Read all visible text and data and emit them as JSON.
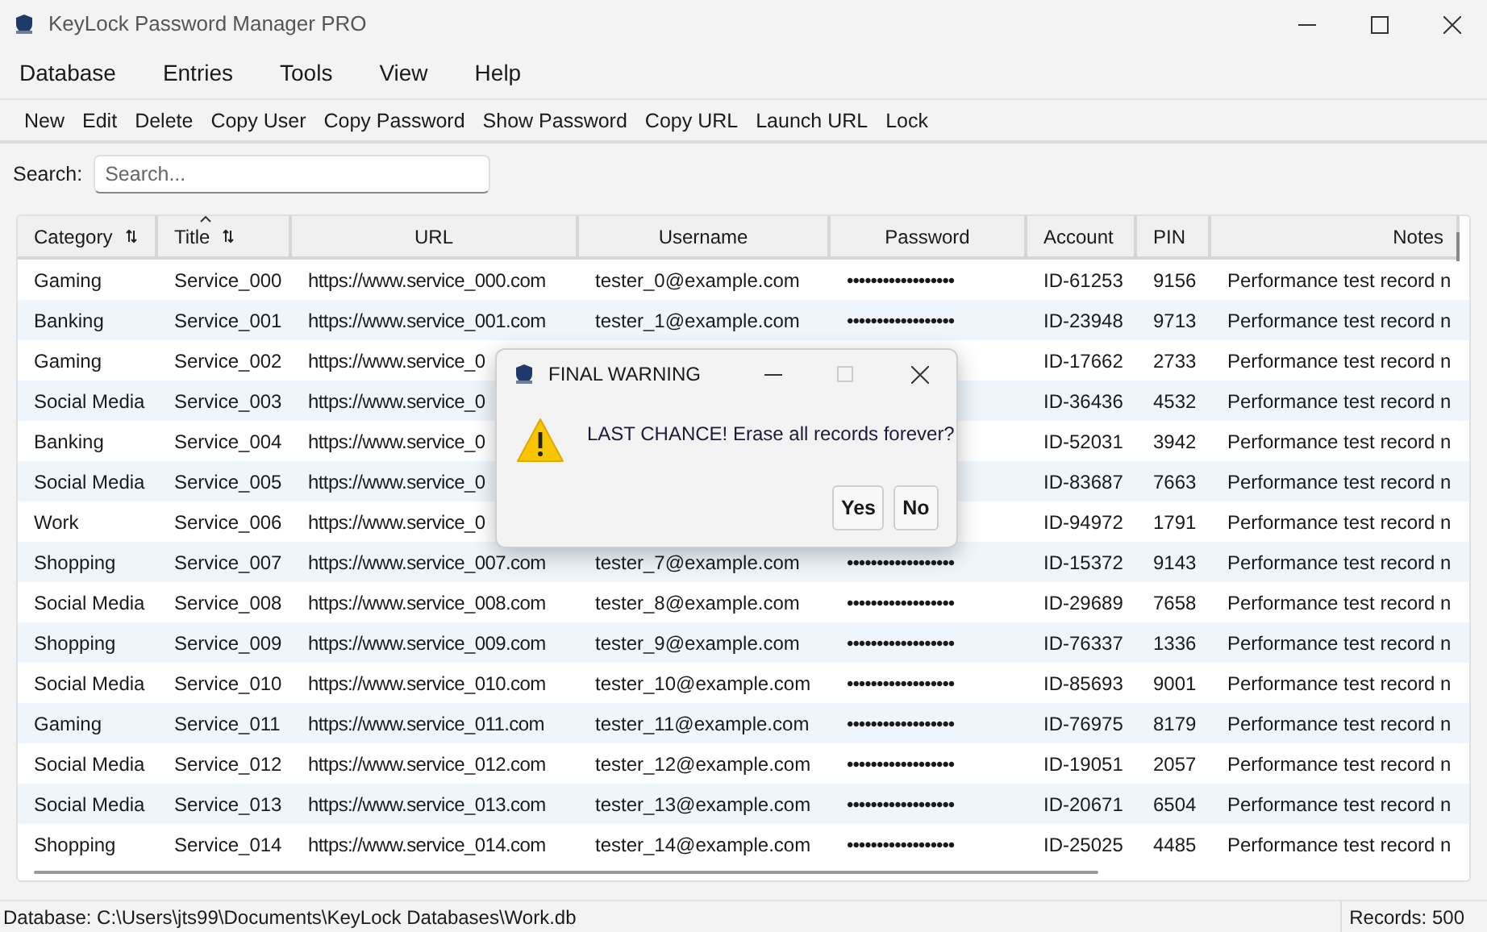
{
  "window": {
    "title": "KeyLock Password Manager PRO"
  },
  "menu": [
    "Database",
    "Entries",
    "Tools",
    "View",
    "Help"
  ],
  "toolbar": [
    "New",
    "Edit",
    "Delete",
    "Copy User",
    "Copy Password",
    "Show Password",
    "Copy URL",
    "Launch URL",
    "Lock"
  ],
  "search": {
    "label": "Search:",
    "placeholder": "Search..."
  },
  "table": {
    "columns": [
      {
        "label": "Category",
        "sortable": true,
        "sorted": false
      },
      {
        "label": "Title",
        "sortable": true,
        "sorted": true
      },
      {
        "label": "URL",
        "sortable": false,
        "sorted": false
      },
      {
        "label": "Username",
        "sortable": false,
        "sorted": false
      },
      {
        "label": "Password",
        "sortable": false,
        "sorted": false
      },
      {
        "label": "Account",
        "sortable": false,
        "sorted": false
      },
      {
        "label": "PIN",
        "sortable": false,
        "sorted": false
      },
      {
        "label": "Notes",
        "sortable": false,
        "sorted": false
      }
    ],
    "rows": [
      {
        "category": "Gaming",
        "title": "Service_000",
        "url": "https://www.service_000.com",
        "username": "tester_0@example.com",
        "password": "••••••••••••••••••",
        "account": "ID-61253",
        "pin": "9156",
        "notes": "Performance test record n"
      },
      {
        "category": "Banking",
        "title": "Service_001",
        "url": "https://www.service_001.com",
        "username": "tester_1@example.com",
        "password": "••••••••••••••••••",
        "account": "ID-23948",
        "pin": "9713",
        "notes": "Performance test record n"
      },
      {
        "category": "Gaming",
        "title": "Service_002",
        "url": "https://www.service_0",
        "account": "ID-17662",
        "pin": "2733",
        "notes": "Performance test record n"
      },
      {
        "category": "Social Media",
        "title": "Service_003",
        "url": "https://www.service_0",
        "account": "ID-36436",
        "pin": "4532",
        "notes": "Performance test record n"
      },
      {
        "category": "Banking",
        "title": "Service_004",
        "url": "https://www.service_0",
        "account": "ID-52031",
        "pin": "3942",
        "notes": "Performance test record n"
      },
      {
        "category": "Social Media",
        "title": "Service_005",
        "url": "https://www.service_0",
        "account": "ID-83687",
        "pin": "7663",
        "notes": "Performance test record n"
      },
      {
        "category": "Work",
        "title": "Service_006",
        "url": "https://www.service_0",
        "account": "ID-94972",
        "pin": "1791",
        "notes": "Performance test record n"
      },
      {
        "category": "Shopping",
        "title": "Service_007",
        "url": "https://www.service_007.com",
        "username": "tester_7@example.com",
        "password": "••••••••••••••••••",
        "account": "ID-15372",
        "pin": "9143",
        "notes": "Performance test record n"
      },
      {
        "category": "Social Media",
        "title": "Service_008",
        "url": "https://www.service_008.com",
        "username": "tester_8@example.com",
        "password": "••••••••••••••••••",
        "account": "ID-29689",
        "pin": "7658",
        "notes": "Performance test record n"
      },
      {
        "category": "Shopping",
        "title": "Service_009",
        "url": "https://www.service_009.com",
        "username": "tester_9@example.com",
        "password": "••••••••••••••••••",
        "account": "ID-76337",
        "pin": "1336",
        "notes": "Performance test record n"
      },
      {
        "category": "Social Media",
        "title": "Service_010",
        "url": "https://www.service_010.com",
        "username": "tester_10@example.com",
        "password": "••••••••••••••••••",
        "account": "ID-85693",
        "pin": "9001",
        "notes": "Performance test record n"
      },
      {
        "category": "Gaming",
        "title": "Service_011",
        "url": "https://www.service_011.com",
        "username": "tester_11@example.com",
        "password": "••••••••••••••••••",
        "account": "ID-76975",
        "pin": "8179",
        "notes": "Performance test record n"
      },
      {
        "category": "Social Media",
        "title": "Service_012",
        "url": "https://www.service_012.com",
        "username": "tester_12@example.com",
        "password": "••••••••••••••••••",
        "account": "ID-19051",
        "pin": "2057",
        "notes": "Performance test record n"
      },
      {
        "category": "Social Media",
        "title": "Service_013",
        "url": "https://www.service_013.com",
        "username": "tester_13@example.com",
        "password": "••••••••••••••••••",
        "account": "ID-20671",
        "pin": "6504",
        "notes": "Performance test record n"
      },
      {
        "category": "Shopping",
        "title": "Service_014",
        "url": "https://www.service_014.com",
        "username": "tester_14@example.com",
        "password": "••••••••••••••••••",
        "account": "ID-25025",
        "pin": "4485",
        "notes": "Performance test record n"
      }
    ]
  },
  "dialog": {
    "title": "FINAL WARNING",
    "message": "LAST CHANCE! Erase all records forever?",
    "buttons": [
      "Yes",
      "No"
    ]
  },
  "status_bar": {
    "path": "Database: C:\\Users\\jts99\\Documents\\KeyLock Databases\\Work.db",
    "count": "Records: 500"
  }
}
